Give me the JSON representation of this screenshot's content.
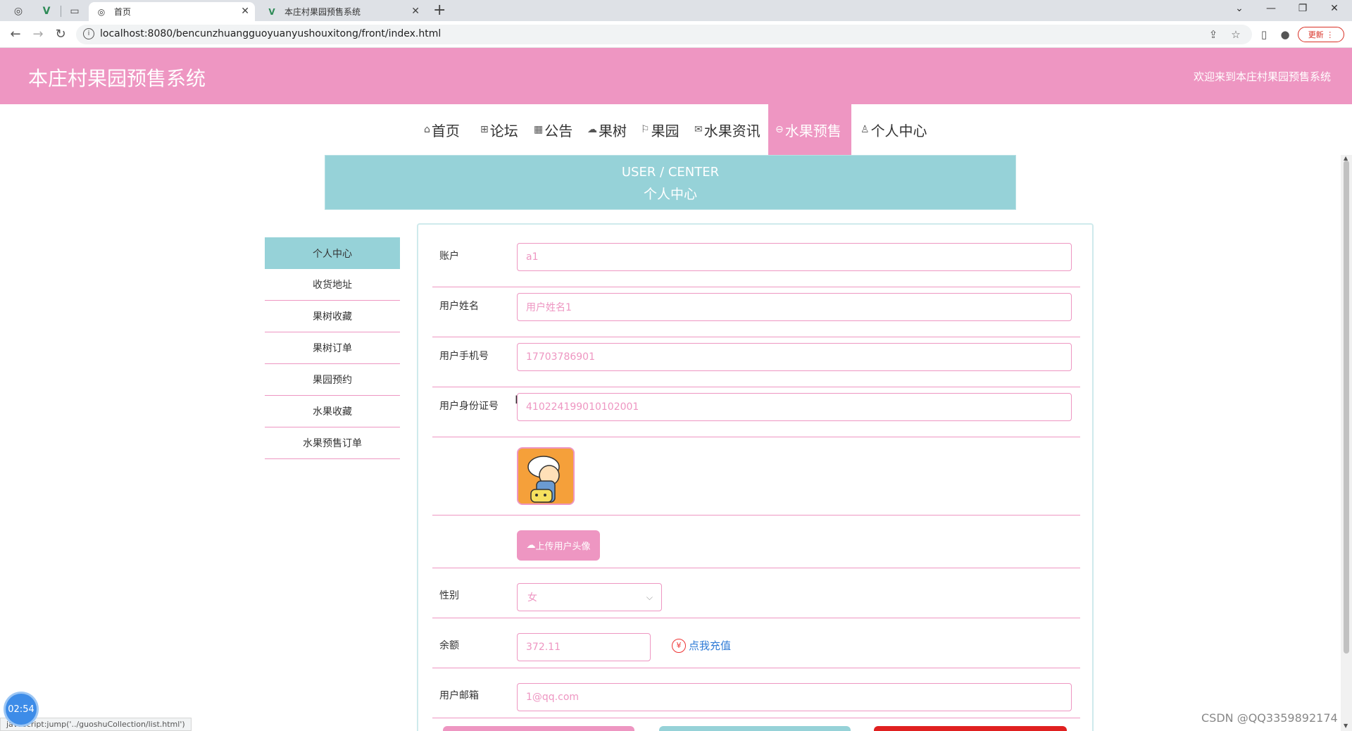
{
  "browser": {
    "tabs": [
      {
        "title": "首页",
        "active": true
      },
      {
        "title": "本庄村果园预售系统",
        "active": false
      }
    ],
    "url": "localhost:8080/bencunzhuangguoyuanyushouxitong/front/index.html",
    "update_label": "更新"
  },
  "header": {
    "title": "本庄村果园预售系统",
    "welcome": "欢迎来到本庄村果园预售系统"
  },
  "nav": {
    "items": [
      {
        "label": "首页",
        "icon": "home-icon"
      },
      {
        "label": "论坛",
        "icon": "forum-icon"
      },
      {
        "label": "公告",
        "icon": "notice-icon"
      },
      {
        "label": "果树",
        "icon": "tree-icon"
      },
      {
        "label": "果园",
        "icon": "flag-icon"
      },
      {
        "label": "水果资讯",
        "icon": "mail-icon"
      },
      {
        "label": "水果预售",
        "icon": "presale-icon",
        "active": true
      },
      {
        "label": "个人中心",
        "icon": "user-icon"
      }
    ]
  },
  "banner": {
    "en": "USER / CENTER",
    "zh": "个人中心"
  },
  "sidebar": {
    "items": [
      {
        "label": "个人中心",
        "active": true
      },
      {
        "label": "收货地址"
      },
      {
        "label": "果树收藏"
      },
      {
        "label": "果树订单"
      },
      {
        "label": "果园预约"
      },
      {
        "label": "水果收藏"
      },
      {
        "label": "水果预售订单"
      }
    ]
  },
  "form": {
    "account": {
      "label": "账户",
      "value": "a1"
    },
    "name": {
      "label": "用户姓名",
      "value": "用户姓名1"
    },
    "phone": {
      "label": "用户手机号",
      "value": "17703786901"
    },
    "id_card": {
      "label": "用户身份证号",
      "value": "410224199010102001"
    },
    "upload_label": "上传用户头像",
    "gender": {
      "label": "性别",
      "value": "女"
    },
    "balance": {
      "label": "余额",
      "value": "372.11",
      "recharge_label": "点我充值",
      "currency_symbol": "¥"
    },
    "email": {
      "label": "用户邮箱",
      "value": "1@qq.com"
    }
  },
  "overlay": {
    "timer": "02:54",
    "status_text": "javascript:jump('../guoshuCollection/list.html')",
    "watermark": "CSDN @QQ3359892174"
  },
  "colors": {
    "brand_pink": "#ee96c2",
    "teal": "#96d2d8",
    "link_blue": "#2f7bd6"
  }
}
